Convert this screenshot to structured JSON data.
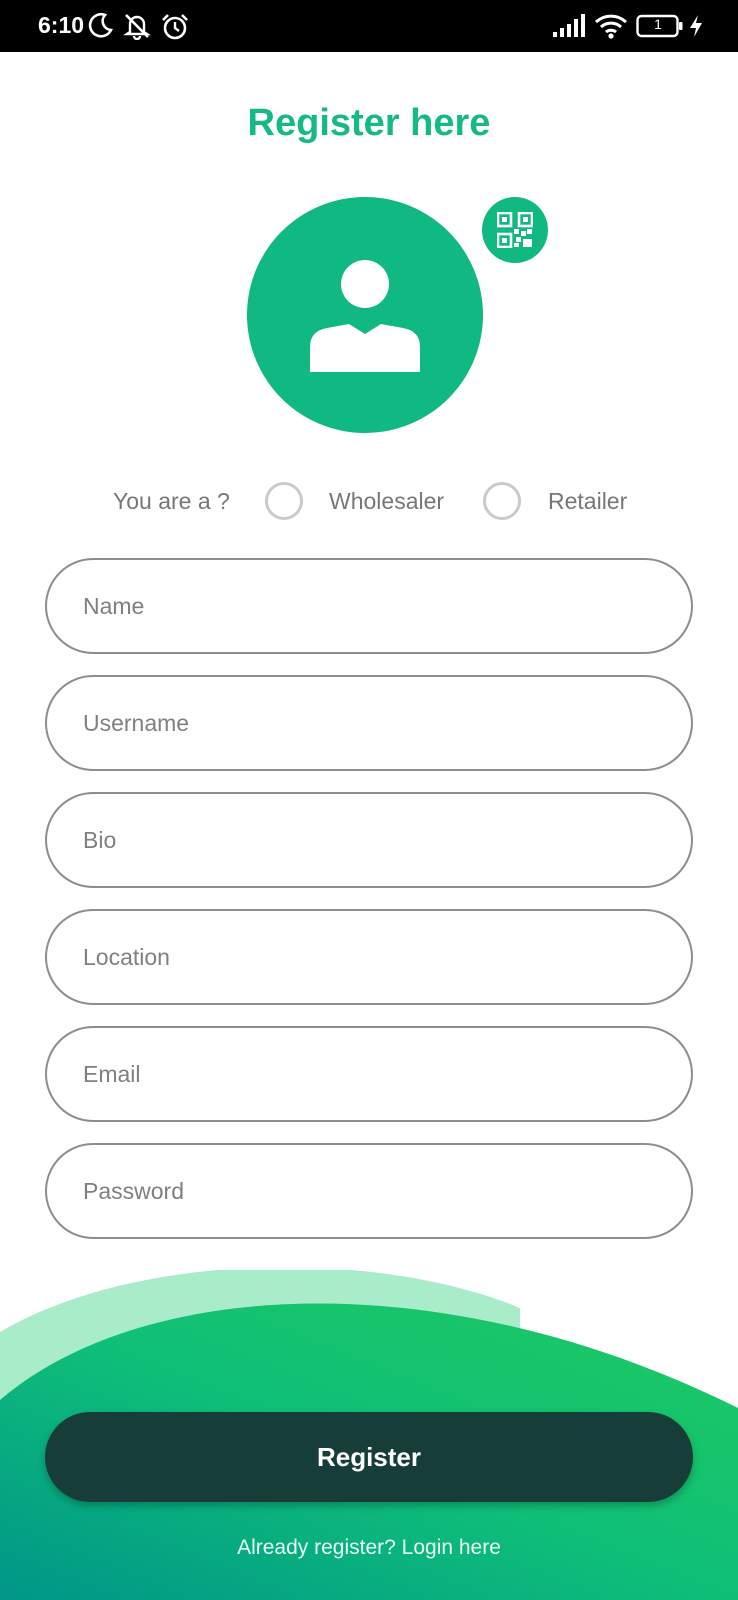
{
  "status_bar": {
    "time": "6:10",
    "battery_level": "1",
    "icons": [
      "moon-icon",
      "notifications-muted-icon",
      "alarm-icon",
      "signal-icon",
      "wifi-icon",
      "battery-icon",
      "charging-icon"
    ]
  },
  "title": "Register here",
  "avatar": {
    "icon": "person-icon",
    "qr_icon": "qr-code-icon"
  },
  "role": {
    "label": "You are a ?",
    "options": [
      "Wholesaler",
      "Retailer"
    ],
    "selected": null
  },
  "form": {
    "fields": [
      {
        "placeholder": "Name",
        "value": ""
      },
      {
        "placeholder": "Username",
        "value": ""
      },
      {
        "placeholder": "Bio",
        "value": ""
      },
      {
        "placeholder": "Location",
        "value": ""
      },
      {
        "placeholder": "Email",
        "value": ""
      },
      {
        "placeholder": "Password",
        "value": ""
      }
    ]
  },
  "register_label": "Register",
  "login_link": "Already register? Login here",
  "colors": {
    "accent": "#10b981",
    "title": "#14b985",
    "button": "#173d38",
    "gradient_start": "#009688",
    "gradient_end": "#1ec95f",
    "wave_light": "#a9ecc9"
  }
}
